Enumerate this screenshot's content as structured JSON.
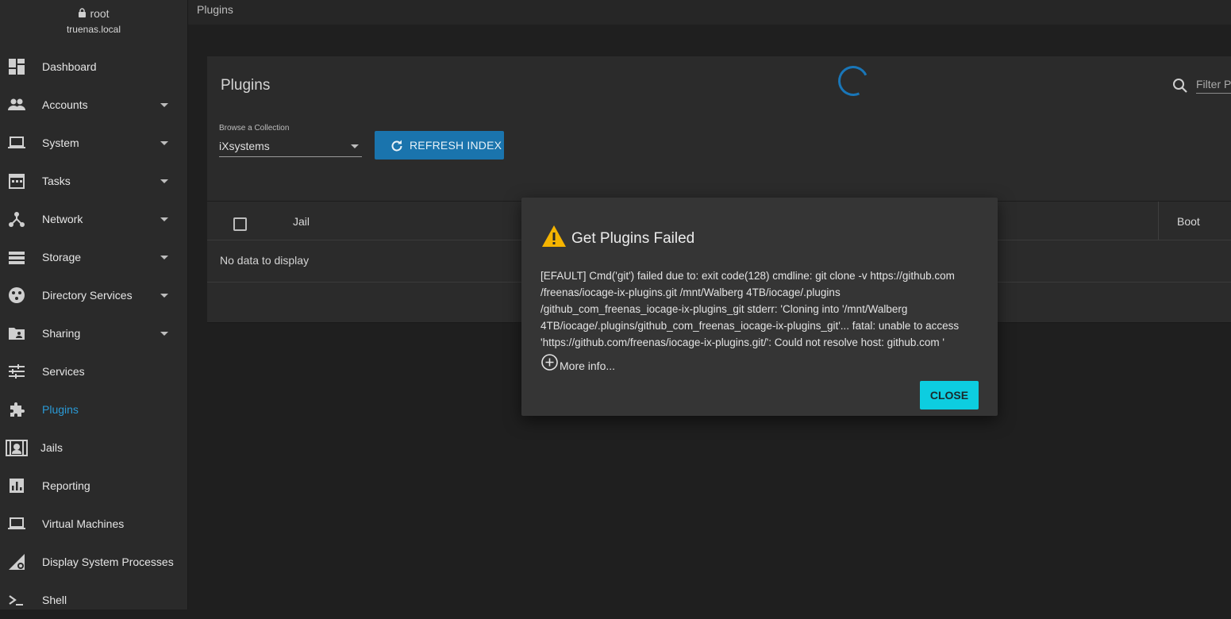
{
  "user": {
    "name": "root",
    "host": "truenas.local"
  },
  "breadcrumb": "Plugins",
  "sidebar": {
    "items": [
      {
        "label": "Dashboard",
        "icon": "dashboard-icon",
        "expandable": false
      },
      {
        "label": "Accounts",
        "icon": "people-icon",
        "expandable": true
      },
      {
        "label": "System",
        "icon": "laptop-icon",
        "expandable": true
      },
      {
        "label": "Tasks",
        "icon": "calendar-icon",
        "expandable": true
      },
      {
        "label": "Network",
        "icon": "network-icon",
        "expandable": true
      },
      {
        "label": "Storage",
        "icon": "storage-icon",
        "expandable": true
      },
      {
        "label": "Directory Services",
        "icon": "directory-icon",
        "expandable": true
      },
      {
        "label": "Sharing",
        "icon": "folder-shared-icon",
        "expandable": true
      },
      {
        "label": "Services",
        "icon": "tune-icon",
        "expandable": false
      },
      {
        "label": "Plugins",
        "icon": "extension-icon",
        "expandable": false,
        "active": true
      },
      {
        "label": "Jails",
        "icon": "jail-icon",
        "expandable": false
      },
      {
        "label": "Reporting",
        "icon": "chart-icon",
        "expandable": false
      },
      {
        "label": "Virtual Machines",
        "icon": "computer-icon",
        "expandable": false
      },
      {
        "label": "Display System Processes",
        "icon": "processes-icon",
        "expandable": false
      },
      {
        "label": "Shell",
        "icon": "shell-icon",
        "expandable": false
      }
    ]
  },
  "card": {
    "title": "Plugins",
    "filter_placeholder": "Filter Plugins",
    "collection_label": "Browse a Collection",
    "collection_value": "iXsystems",
    "refresh_label": "REFRESH INDEX",
    "columns": [
      "Jail",
      "Boot"
    ],
    "empty_text": "No data to display"
  },
  "dialog": {
    "title": "Get Plugins Failed",
    "message_lines": [
      "[EFAULT] Cmd('git') failed due to: exit code(128) cmdline: git clone -v https://github.com",
      "/freenas/iocage-ix-plugins.git /mnt/Walberg 4TB/iocage/.plugins",
      "/github_com_freenas_iocage-ix-plugins_git stderr: 'Cloning into '/mnt/Walberg",
      "4TB/iocage/.plugins/github_com_freenas_iocage-ix-plugins_git'... fatal: unable to access",
      "'https://github.com/freenas/iocage-ix-plugins.git/': Could not resolve host: github.com '"
    ],
    "more_info": "More info...",
    "close_label": "CLOSE"
  },
  "colors": {
    "accent": "#1a74ad",
    "active_nav": "#2a9ad6",
    "close_button": "#0dcde0",
    "warning": "#f5b400"
  }
}
